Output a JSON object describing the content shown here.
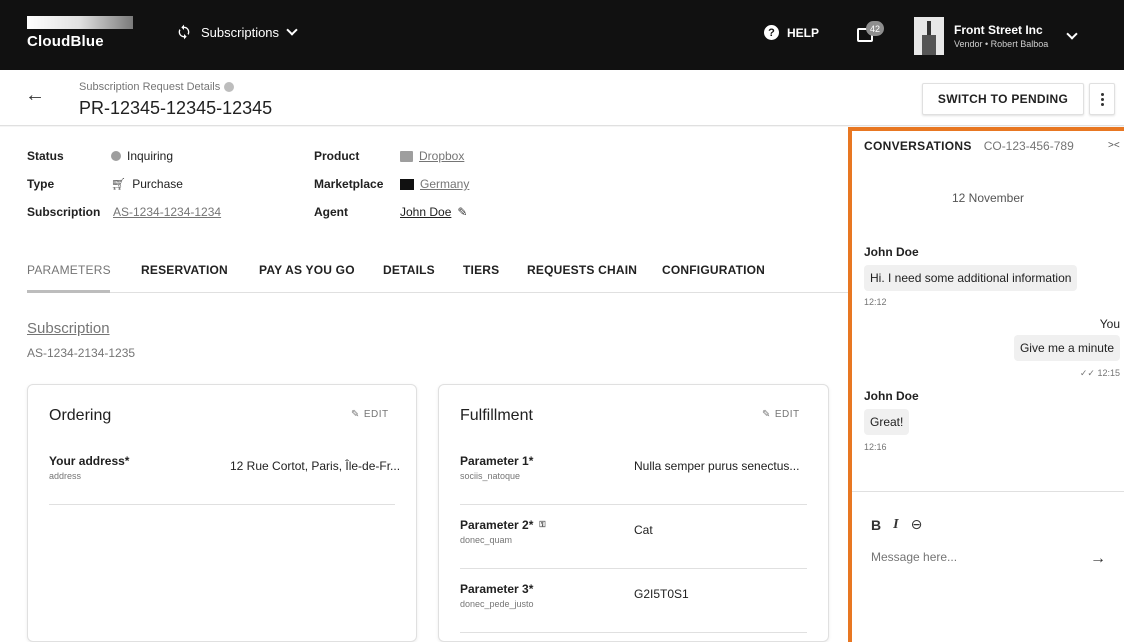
{
  "topbar": {
    "logo_text": "CloudBlue",
    "app_switcher": "Subscriptions",
    "help_label": "HELP",
    "notification_count": "42",
    "account_name": "Front Street Inc",
    "account_sub": "Vendor • Robert Balboa"
  },
  "page": {
    "subtitle": "Subscription Request Details",
    "title": "PR-12345-12345-12345",
    "switch_label": "SWITCH TO PENDING"
  },
  "info": {
    "status_label": "Status",
    "status_value": "Inquiring",
    "type_label": "Type",
    "type_value": "Purchase",
    "subscription_label": "Subscription",
    "subscription_value": "AS-1234-1234-1234",
    "product_label": "Product",
    "product_value": "Dropbox",
    "marketplace_label": "Marketplace",
    "marketplace_value": "Germany",
    "agent_label": "Agent",
    "agent_value": "John Doe"
  },
  "tabs": [
    "PARAMETERS",
    "RESERVATION",
    "PAY AS YOU GO",
    "DETAILS",
    "TIERS",
    "REQUESTS CHAIN",
    "CONFIGURATION"
  ],
  "subscription_section": {
    "link": "Subscription",
    "id": "AS-1234-2134-1235"
  },
  "ordering": {
    "title": "Ordering",
    "edit_label": "EDIT",
    "params": [
      {
        "name": "Your address*",
        "key": "address",
        "value": "12 Rue Cortot, Paris, Île-de-Fr..."
      }
    ]
  },
  "fulfillment": {
    "title": "Fulfillment",
    "edit_label": "EDIT",
    "params": [
      {
        "name": "Parameter 1*",
        "key": "sociis_natoque",
        "value": "Nulla semper purus senectus..."
      },
      {
        "name": "Parameter 2*",
        "key": "donec_quam",
        "value": "Cat"
      },
      {
        "name": "Parameter 3*",
        "key": "donec_pede_justo",
        "value": "G2I5T0S1"
      }
    ]
  },
  "conversation": {
    "title": "CONVERSATIONS",
    "id": "CO-123-456-789",
    "date": "12 November",
    "messages": [
      {
        "author": "John Doe",
        "text": "Hi. I need some additional information",
        "time": "12:12"
      },
      {
        "author": "You",
        "text": "Give me a minute",
        "time": "12:15"
      },
      {
        "author": "John Doe",
        "text": "Great!",
        "time": "12:16"
      }
    ],
    "placeholder": "Message here..."
  }
}
